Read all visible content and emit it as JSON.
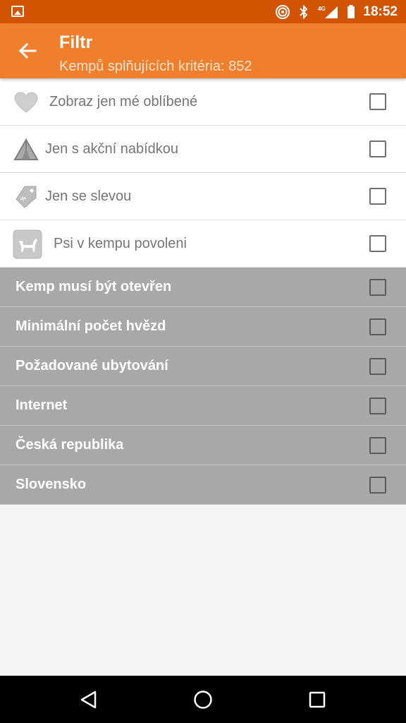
{
  "status_bar": {
    "network_label": "4G",
    "time": "18:52",
    "icons": [
      "image-notification-icon",
      "hotspot-icon",
      "bluetooth-icon",
      "signal-icon",
      "battery-icon"
    ]
  },
  "toolbar": {
    "title": "Filtr",
    "subtitle": "Kempů splňujících kritéria: 852",
    "back_icon": "arrow-back-icon",
    "background_color": "#f07f2d"
  },
  "filters": [
    {
      "label": "Zobraz jen mé oblíbené",
      "icon": "heart-icon",
      "checked": false
    },
    {
      "label": "Jen s akční nabídkou",
      "icon": "tent-icon",
      "checked": false
    },
    {
      "label": "Jen se slevou",
      "icon": "discount-tag-icon",
      "checked": false
    },
    {
      "label": "Psi v kempu povoleni",
      "icon": "dog-icon",
      "checked": false
    }
  ],
  "sections": [
    {
      "label": "Kemp musí být otevřen",
      "checked": false
    },
    {
      "label": "Minimální počet hvězd",
      "checked": false
    },
    {
      "label": "Požadované ubytování",
      "checked": false
    },
    {
      "label": "Internet",
      "checked": false
    },
    {
      "label": "Česká republika",
      "checked": false
    },
    {
      "label": "Slovensko",
      "checked": false
    }
  ],
  "nav_bar": {
    "icons": [
      "nav-back-icon",
      "nav-home-icon",
      "nav-recents-icon"
    ]
  }
}
